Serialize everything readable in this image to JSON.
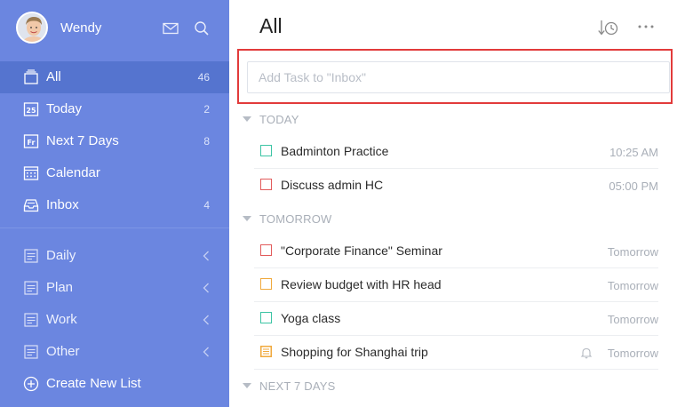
{
  "user": {
    "name": "Wendy"
  },
  "sidebar": {
    "smart_lists": [
      {
        "label": "All",
        "count": "46",
        "icon": "all-stack-icon",
        "active": true
      },
      {
        "label": "Today",
        "count": "2",
        "icon": "calendar-25-icon"
      },
      {
        "label": "Next 7 Days",
        "count": "8",
        "icon": "calendar-fr-icon"
      },
      {
        "label": "Calendar",
        "count": "",
        "icon": "calendar-grid-icon"
      },
      {
        "label": "Inbox",
        "count": "4",
        "icon": "inbox-tray-icon"
      }
    ],
    "lists": [
      {
        "label": "Daily"
      },
      {
        "label": "Plan"
      },
      {
        "label": "Work"
      },
      {
        "label": "Other"
      }
    ],
    "create_label": "Create New List"
  },
  "main": {
    "title": "All",
    "add_task_placeholder": "Add Task to \"Inbox\"",
    "sections": [
      {
        "label": "TODAY"
      },
      {
        "label": "TOMORROW"
      },
      {
        "label": "NEXT 7 DAYS"
      }
    ],
    "tasks": [
      {
        "title": "Badminton Practice",
        "date": "10:25 AM",
        "color": "#3cc4a4"
      },
      {
        "title": "Discuss admin HC",
        "date": "05:00 PM",
        "color": "#e25b5b"
      },
      {
        "title": "\"Corporate Finance\" Seminar",
        "date": "Tomorrow",
        "color": "#e25b5b"
      },
      {
        "title": "Review budget with HR head",
        "date": "Tomorrow",
        "color": "#f0a93c"
      },
      {
        "title": "Yoga class",
        "date": "Tomorrow",
        "color": "#3cc4a4"
      },
      {
        "title": "Shopping for Shanghai trip",
        "date": "Tomorrow",
        "color": "#f0a93c",
        "has_reminder": true
      }
    ]
  },
  "colors": {
    "sidebar": "#6b86e0",
    "sidebar_active": "#5574cf",
    "highlight": "#e23b3b"
  }
}
